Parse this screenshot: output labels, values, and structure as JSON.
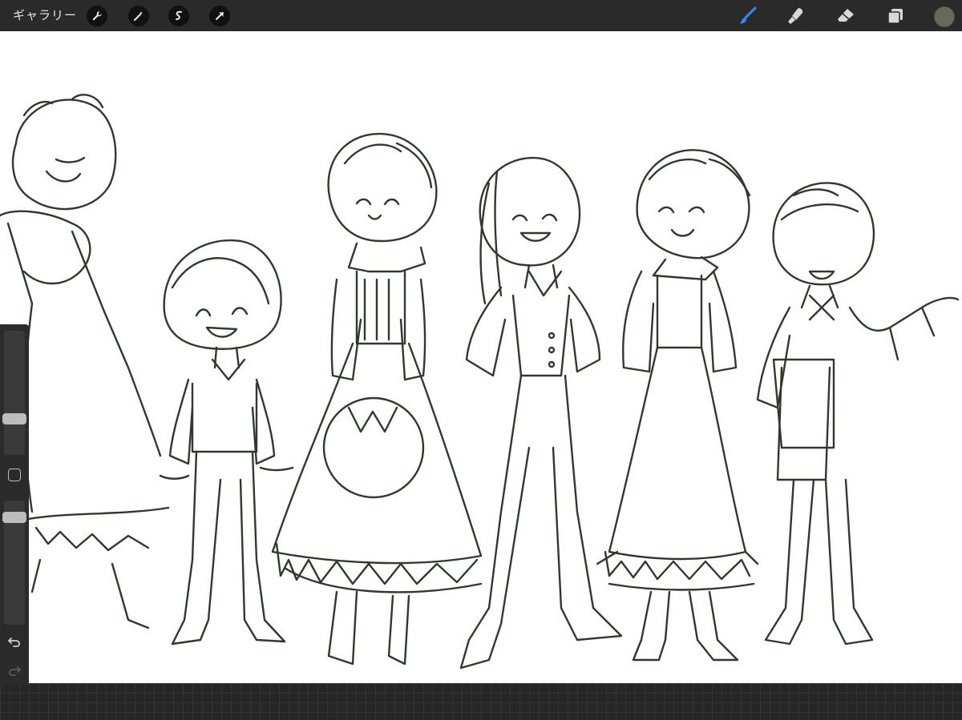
{
  "topbar": {
    "gallery_label": "ギャラリー",
    "left_tools": [
      "wrench-icon",
      "magic-wand-icon",
      "selection-icon",
      "transform-arrow-icon"
    ],
    "right_tools": [
      "brush-icon",
      "smudge-icon",
      "eraser-icon",
      "layers-icon"
    ],
    "active_tool": "brush",
    "active_color": "#646a5e",
    "brush_active_color": "#3b82f6"
  },
  "sidebar": {
    "brush_size_level": 0.27,
    "brush_opacity_level": 0.9
  }
}
